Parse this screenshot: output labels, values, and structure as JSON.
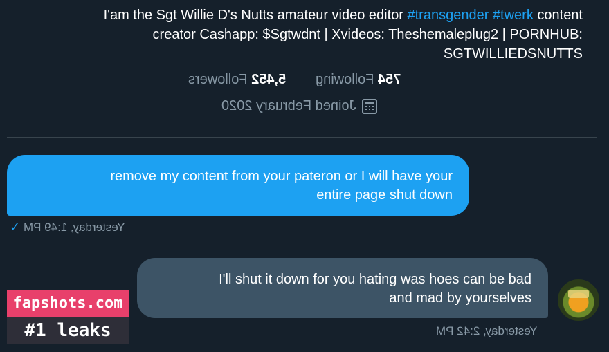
{
  "profile": {
    "bio_line1_text": "I'am the Sgt Willie D's Nutts amateur video editor ",
    "bio_line1_hashtags": "#transgender #twerk",
    "bio_line1_end": " content",
    "bio_line2": "creator Cashapp: $Sgtwdnt | Xvideos: Theshemaleplug2 | PORNHUB:",
    "bio_line3": "SGTWILLIEDSNUTTS",
    "following_count": "754",
    "following_label": "Following",
    "followers_count": "5,452",
    "followers_label": "Followers",
    "joined": "Joined February 2020",
    "calendar_icon": "calendar-icon"
  },
  "messages": [
    {
      "line1": "remove my content from your pateron or I will have your",
      "line2": "entire page shut down",
      "timestamp": "Yesterday, 1:49 PM",
      "status_icon": "check-icon",
      "color": "#1da1f2"
    },
    {
      "line1": "I'll shut it down for you hating was hoes can be bad",
      "line2": "and mad by yourselves",
      "timestamp": "Yesterday, 2:42 PM",
      "color": "#3d5466"
    }
  ],
  "watermark": {
    "site": "fapshots.com",
    "tagline": "#1 leaks",
    "site_color": "#e8406b"
  }
}
